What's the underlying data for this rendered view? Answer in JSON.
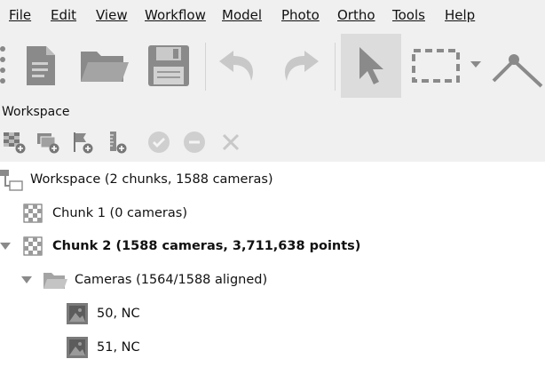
{
  "menu": {
    "file": "File",
    "edit": "Edit",
    "view": "View",
    "workflow": "Workflow",
    "model": "Model",
    "photo": "Photo",
    "ortho": "Ortho",
    "tools": "Tools",
    "help": "Help"
  },
  "toolbar": {
    "icons": [
      "new-document-icon",
      "open-folder-icon",
      "save-floppy-icon",
      "undo-icon",
      "redo-icon",
      "select-arrow-icon",
      "rectangle-selection-icon",
      "ruler-icon"
    ]
  },
  "workspace": {
    "label": "Workspace",
    "tree": {
      "root": "Workspace (2 chunks, 1588 cameras)",
      "chunk1": "Chunk 1 (0 cameras)",
      "chunk2": "Chunk 2 (1588 cameras, 3,711,638 points)",
      "cameras": "Cameras (1564/1588 aligned)",
      "camera_a": "50, NC",
      "camera_b": "51, NC"
    }
  },
  "colors": {
    "background": "#f0f0f0",
    "tree_background": "#ffffff",
    "icon_gray": "#8a8a8a",
    "icon_disabled": "#c8c8c8"
  }
}
